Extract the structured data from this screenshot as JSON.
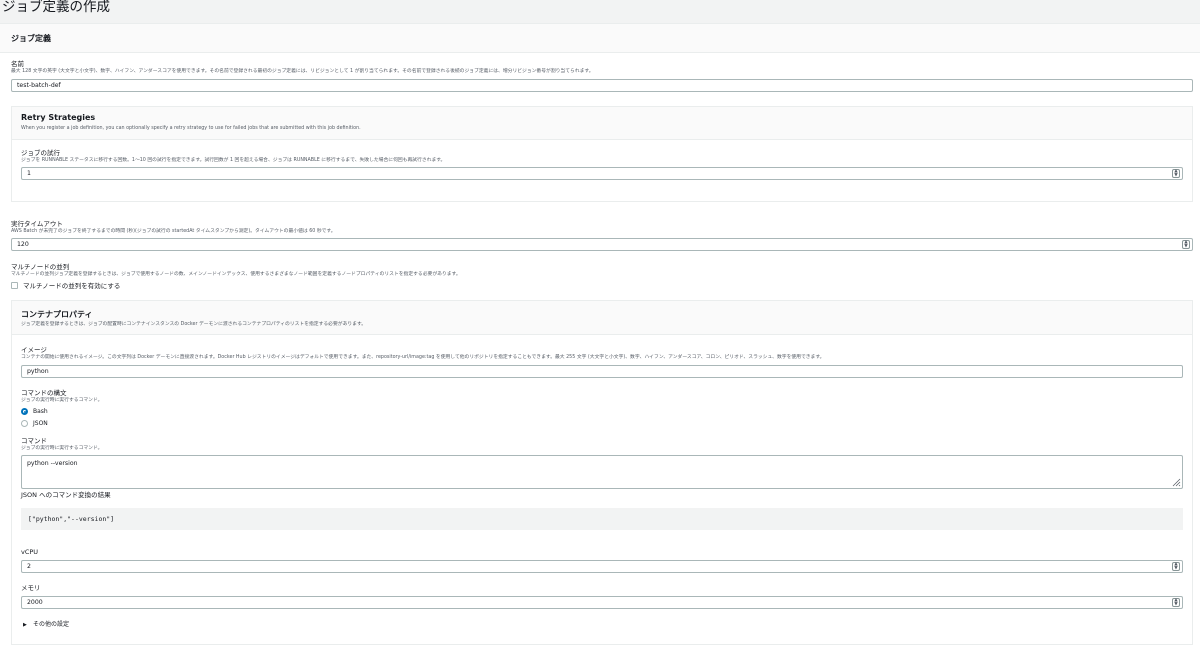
{
  "page": {
    "title": "ジョブ定義の作成"
  },
  "job_definition": {
    "section_title": "ジョブ定義",
    "name": {
      "label": "名前",
      "description": "最大 128 文字の英字 (大文字と小文字)、数字、ハイフン、アンダースコアを使用できます。その名前で登録される最初のジョブ定義には、リビジョンとして 1 が割り当てられます。その名前で登録される後続のジョブ定義には、増分リビジョン番号が割り当てられます。",
      "value": "test-batch-def"
    },
    "retry": {
      "title": "Retry Strategies",
      "description": "When you register a job definition, you can optionally specify a retry strategy to use for failed jobs that are submitted with this job definition.",
      "attempts_label": "ジョブの試行",
      "attempts_description": "ジョブを RUNNABLE ステータスに移行する回数。1〜10 回の試行を指定できます。試行回数が 1 回を超える場合、ジョブは RUNNABLE に移行するまで、失敗した場合に何回も再試行されます。",
      "attempts_value": "1"
    },
    "timeout": {
      "label": "実行タイムアウト",
      "description": "AWS Batch が未完了のジョブを終了するまでの時間 (秒)(ジョブの試行の startedAt タイムスタンプから測定)。タイムアウトの最小値は 60 秒です。",
      "value": "120"
    },
    "multinode": {
      "label": "マルチノードの並列",
      "description": "マルチノードの並列ジョブ定義を登録するときは、ジョブで使用するノードの数、メインノードインデックス、使用するさまざまなノード範囲を定義するノードプロパティのリストを指定する必要があります。",
      "checkbox_label": "マルチノードの並列を有効にする"
    },
    "container": {
      "title": "コンテナプロパティ",
      "description": "ジョブ定義を登録するときは、ジョブの配置時にコンテナインスタンスの Docker デーモンに渡されるコンテナプロパティのリストを指定する必要があります。",
      "image_label": "イメージ",
      "image_description": "コンテナの開始に使用されるイメージ。この文字列は Docker デーモンに直接渡されます。Docker Hub レジストリのイメージはデフォルトで使用できます。また、repository-url/image:tag を使用して他のリポジトリを指定することもできます。最大 255 文字 (大文字と小文字)、数字、ハイフン、アンダースコア、コロン、ピリオド、スラッシュ、数字を使用できます。",
      "image_value": "python",
      "syntax_label": "コマンドの構文",
      "syntax_description": "ジョブの実行時に実行するコマンド。",
      "syntax_options": [
        "Bash",
        "JSON"
      ],
      "syntax_selected": "Bash",
      "command_label": "コマンド",
      "command_description": "ジョブの実行時に実行するコマンド。",
      "command_value": "python --version",
      "json_result_label": "JSON へのコマンド変換の結果",
      "json_result_value": "[\"python\",\"--version\"]",
      "vcpu_label": "vCPU",
      "vcpu_value": "2",
      "memory_label": "メモリ",
      "memory_value": "2000",
      "other_settings_label": "その他の設定"
    }
  },
  "icons": {
    "spinner": "up-down-spinner-icon",
    "expand": "caret-right-icon",
    "resize": "resize-grip-icon"
  },
  "colors": {
    "accent": "#0073bb",
    "panel_bg": "#ffffff",
    "page_bg": "#f2f3f3"
  }
}
